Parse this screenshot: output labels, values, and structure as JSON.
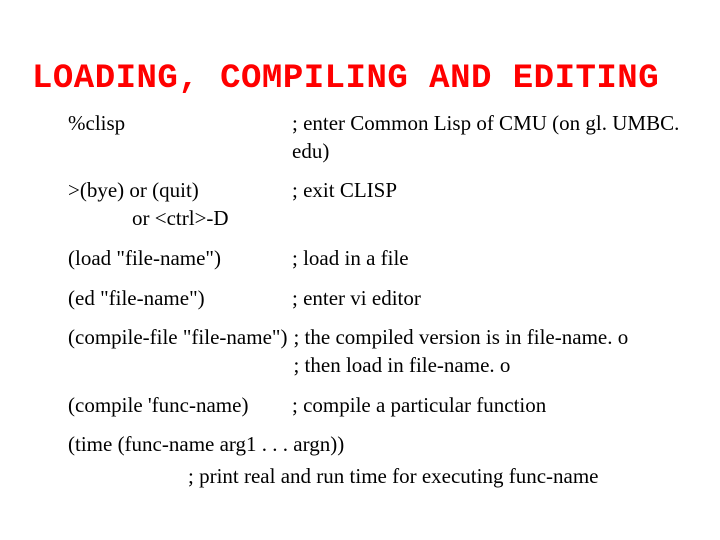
{
  "title": "LOADING, COMPILING AND EDITING",
  "rows": {
    "r0": {
      "cmd": "%clisp",
      "comment": "; enter Common Lisp of CMU (on gl. UMBC. edu)"
    },
    "r1": {
      "cmd_line1": ">(bye) or (quit)",
      "cmd_line2": "or <ctrl>-D",
      "comment": "; exit CLISP"
    },
    "r2": {
      "cmd": "(load \"file-name\")",
      "comment": "; load in a file"
    },
    "r3": {
      "cmd": "(ed \"file-name\")",
      "comment": "; enter vi editor"
    },
    "r4": {
      "cmd": "(compile-file \"file-name\")",
      "comment_line1": "; the compiled version is in file-name. o",
      "comment_line2": "; then load in file-name. o"
    },
    "r5": {
      "cmd": "(compile 'func-name)",
      "comment": "; compile a particular function"
    },
    "r6": {
      "cmd": "(time (func-name arg1 . . . argn))",
      "comment": "; print real and run time for executing func-name"
    }
  }
}
